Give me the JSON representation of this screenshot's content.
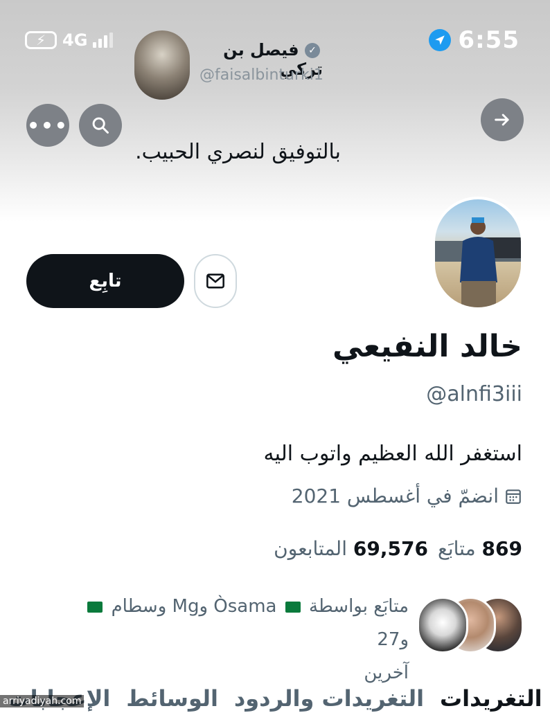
{
  "status_bar": {
    "battery_icon": "bolt-battery-icon",
    "network": "4G",
    "time": "6:55"
  },
  "tweet_author": {
    "name": "فيصل بن تركي",
    "handle": "@faisalbinturki1"
  },
  "nav": {
    "more_icon": "more-icon",
    "search_icon": "search-icon",
    "forward_icon": "arrow-right-icon"
  },
  "tweet": {
    "text": "بالتوفيق لنصري الحبيب."
  },
  "profile": {
    "follow_label": "تابِع",
    "display_name": "خالد النفيعي",
    "handle": "@alnfi3iii",
    "bio": "استغفر الله العظيم واتوب اليه",
    "joined": "انضمّ في أغسطس 2021",
    "following_count": "869",
    "following_label": "متابَع",
    "followers_count": "69,576",
    "followers_label": "المتابعون",
    "followed_by_prefix": "متابَع بواسطة",
    "followed_by_name1": "Òsama",
    "followed_by_and": "وMg وسطام",
    "followed_by_suffix": "و27",
    "followed_by_others": "آخرين"
  },
  "tabs": [
    "التغريدات",
    "التغريدات والردود",
    "الوسائط",
    "الإعجابات"
  ],
  "watermark": "arriyadiyah.com",
  "colors": {
    "accent": "#1d9bf0",
    "button_dark": "#0f1419",
    "muted": "#536471",
    "flag": "#0a7a3c"
  }
}
